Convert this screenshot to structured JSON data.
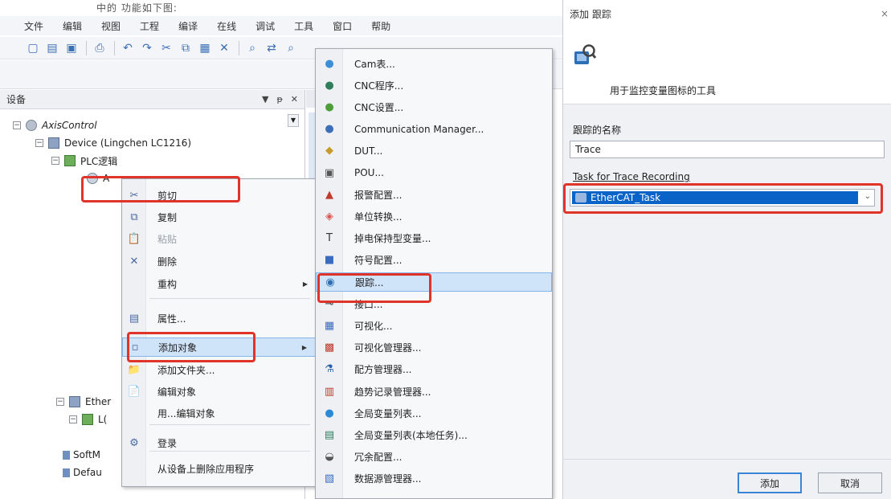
{
  "ide": {
    "caption_text": "中的 功能如下图:",
    "menu": [
      "文件",
      "编辑",
      "视图",
      "工程",
      "编译",
      "在线",
      "调试",
      "工具",
      "窗口",
      "帮助"
    ],
    "devices_panel": {
      "title": "设备",
      "header_buttons": [
        "▼",
        "ᵽ",
        "✕"
      ],
      "tree": [
        {
          "label": "AxisControl",
          "italic": true,
          "expander": "−",
          "icon": "axis"
        },
        {
          "label": "Device (Lingchen LC1216)",
          "italic": false,
          "expander": "−",
          "icon": "device"
        },
        {
          "label": "PLC逻辑",
          "italic": false,
          "expander": "−",
          "icon": "plc"
        },
        {
          "label": "A",
          "italic": false,
          "expander": "",
          "icon": "app"
        },
        {
          "label": "Ether",
          "italic": false,
          "expander": "−",
          "icon": "device"
        },
        {
          "label": "L(",
          "italic": false,
          "expander": "−",
          "icon": "plc"
        },
        {
          "label": "SoftM",
          "italic": false,
          "expander": "",
          "icon": "mini"
        },
        {
          "label": "Defau",
          "italic": false,
          "expander": "",
          "icon": "mini"
        }
      ]
    }
  },
  "context_menu": {
    "items": [
      {
        "label": "剪切",
        "icon": "✂",
        "arrow": "",
        "disabled": false
      },
      {
        "label": "复制",
        "icon": "⧉",
        "arrow": "",
        "disabled": false
      },
      {
        "label": "粘贴",
        "icon": "📋",
        "arrow": "",
        "disabled": true
      },
      {
        "label": "删除",
        "icon": "✕",
        "arrow": "",
        "disabled": false
      },
      {
        "label": "重构",
        "icon": "",
        "arrow": "▶",
        "disabled": false
      },
      {
        "label": "属性...",
        "icon": "▤",
        "arrow": "",
        "disabled": false
      },
      {
        "label": "添加对象",
        "icon": "▫",
        "arrow": "▶",
        "disabled": false
      },
      {
        "label": "添加文件夹...",
        "icon": "📁",
        "arrow": "",
        "disabled": false
      },
      {
        "label": "编辑对象",
        "icon": "📄",
        "arrow": "",
        "disabled": false
      },
      {
        "label": "用...编辑对象",
        "icon": "",
        "arrow": "",
        "disabled": false
      },
      {
        "label": "登录",
        "icon": "⚙",
        "arrow": "",
        "disabled": false
      },
      {
        "label": "从设备上删除应用程序",
        "icon": "",
        "arrow": "",
        "disabled": false
      }
    ]
  },
  "sub_menu": {
    "items": [
      {
        "label": "Cam表...",
        "icon": "●",
        "color": "#3a8fd8"
      },
      {
        "label": "CNC程序...",
        "icon": "●",
        "color": "#2e7d5b"
      },
      {
        "label": "CNC设置...",
        "icon": "●",
        "color": "#4f9e3c"
      },
      {
        "label": "Communication Manager...",
        "icon": "●",
        "color": "#3c6fb8"
      },
      {
        "label": "DUT...",
        "icon": "◆",
        "color": "#c79a2a"
      },
      {
        "label": "POU...",
        "icon": "▣",
        "color": "#555555"
      },
      {
        "label": "报警配置...",
        "icon": "▲",
        "color": "#c0392b"
      },
      {
        "label": "单位转换...",
        "icon": "◈",
        "color": "#d9534f"
      },
      {
        "label": "掉电保持型变量...",
        "icon": "T",
        "color": "#333333"
      },
      {
        "label": "符号配置...",
        "icon": "■",
        "color": "#3a6bc0"
      },
      {
        "label": "跟踪...",
        "icon": "◉",
        "color": "#2d6fb0"
      },
      {
        "label": "接口...",
        "icon": "⊸",
        "color": "#333333"
      },
      {
        "label": "可视化...",
        "icon": "▦",
        "color": "#3a6bc0"
      },
      {
        "label": "可视化管理器...",
        "icon": "▩",
        "color": "#c0392b"
      },
      {
        "label": "配方管理器...",
        "icon": "⚗",
        "color": "#2a5ea8"
      },
      {
        "label": "趋势记录管理器...",
        "icon": "▥",
        "color": "#c0392b"
      },
      {
        "label": "全局变量列表...",
        "icon": "●",
        "color": "#2a8ad8"
      },
      {
        "label": "全局变量列表(本地任务)...",
        "icon": "▤",
        "color": "#2e7d5b"
      },
      {
        "label": "冗余配置...",
        "icon": "◒",
        "color": "#555555"
      },
      {
        "label": "数据源管理器...",
        "icon": "▧",
        "color": "#3a6bc0"
      }
    ]
  },
  "dialog": {
    "title": "添加 跟踪",
    "close": "×",
    "banner_text": "用于监控变量图标的工具",
    "trace_name_label": "跟踪的名称",
    "trace_name_value": "Trace",
    "task_label": "Task for Trace Recording",
    "task_value": "EtherCAT_Task",
    "add_button": "添加",
    "cancel_button": "取消"
  },
  "colors": {
    "highlight_red": "#e0342b",
    "selection_blue": "#0a64c8",
    "menu_highlight": "#cfe3f9"
  }
}
